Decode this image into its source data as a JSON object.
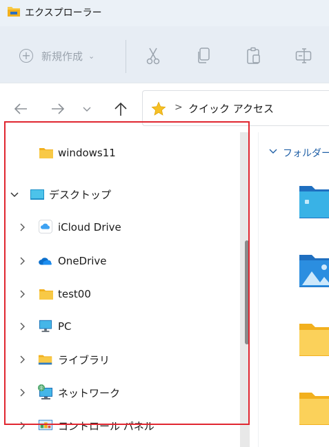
{
  "window": {
    "title": "エクスプローラー"
  },
  "commandbar": {
    "new_label": "新規作成",
    "new_icon": "plus-circle-icon",
    "chevron": "⌄",
    "tools": [
      "cut-icon",
      "copy-icon",
      "paste-icon",
      "rename-icon"
    ]
  },
  "address": {
    "star_icon": "star-icon",
    "separator": ">",
    "crumb": "クイック アクセス"
  },
  "navpane": {
    "items": [
      {
        "label": "windows11",
        "icon": "folder-icon",
        "expander": "none",
        "indent": 1
      },
      {
        "label": "デスクトップ",
        "icon": "desktop-folder-icon",
        "expander": "expanded",
        "indent": 0
      },
      {
        "label": "iCloud Drive",
        "icon": "icloud-icon",
        "expander": "collapsed",
        "indent": 1
      },
      {
        "label": "OneDrive",
        "icon": "onedrive-icon",
        "expander": "collapsed",
        "indent": 1
      },
      {
        "label": "test00",
        "icon": "folder-icon",
        "expander": "collapsed",
        "indent": 1
      },
      {
        "label": "PC",
        "icon": "pc-icon",
        "expander": "collapsed",
        "indent": 1
      },
      {
        "label": "ライブラリ",
        "icon": "library-icon",
        "expander": "collapsed",
        "indent": 1
      },
      {
        "label": "ネットワーク",
        "icon": "network-icon",
        "expander": "collapsed",
        "indent": 1
      },
      {
        "label": "コントロール パネル",
        "icon": "control-panel-icon",
        "expander": "collapsed",
        "indent": 1
      }
    ]
  },
  "content": {
    "group_header": "フォルダー",
    "tiles": [
      "desktop-folder-tile-icon",
      "pictures-folder-tile-icon",
      "folder-tile-icon",
      "folder-tile-icon"
    ]
  },
  "colors": {
    "highlight": "#e0252f",
    "folder_yellow": "#f8c946",
    "accent_blue": "#1f5fa6"
  }
}
